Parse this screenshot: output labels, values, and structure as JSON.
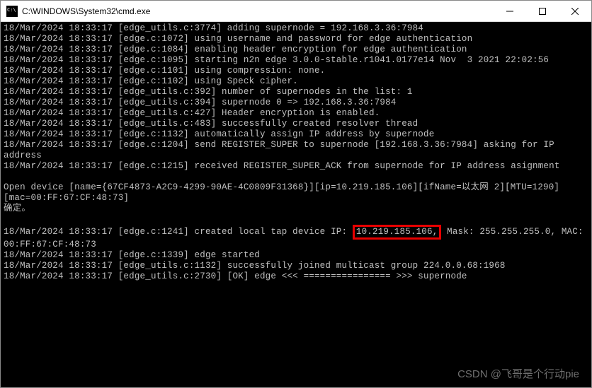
{
  "window": {
    "title": "C:\\WINDOWS\\System32\\cmd.exe"
  },
  "log": {
    "ts": "18/Mar/2024 18:33:17",
    "l1": "[edge_utils.c:3774] adding supernode = 192.168.3.36:7984",
    "l2": "[edge.c:1072] using username and password for edge authentication",
    "l3": "[edge.c:1084] enabling header encryption for edge authentication",
    "l4": "[edge.c:1095] starting n2n edge 3.0.0-stable.r1041.0177e14 Nov  3 2021 22:02:56",
    "l5": "[edge.c:1101] using compression: none.",
    "l6": "[edge.c:1102] using Speck cipher.",
    "l7": "[edge_utils.c:392] number of supernodes in the list: 1",
    "l8": "[edge_utils.c:394] supernode 0 => 192.168.3.36:7984",
    "l9": "[edge_utils.c:427] Header encryption is enabled.",
    "l10": "[edge_utils.c:483] successfully created resolver thread",
    "l11": "[edge.c:1132] automatically assign IP address by supernode",
    "l12": "[edge.c:1204] send REGISTER_SUPER to supernode [192.168.3.36:7984] asking for IP address",
    "l13": "[edge.c:1215] received REGISTER_SUPER_ACK from supernode for IP address asignment",
    "opendev": "Open device [name={67CF4873-A2C9-4299-90AE-4C0809F31368}][ip=10.219.185.106][ifName=以太网 2][MTU=1290][mac=00:FF:67:CF:48:73]",
    "ok": "确定。",
    "created_prefix": "[edge.c:1241] created local tap device IP: ",
    "created_ip": "10.219.185.106,",
    "created_suffix": " Mask: 255.255.255.0, MAC: 00:FF:67:CF:48:73",
    "l15": "[edge.c:1339] edge started",
    "l16": "[edge_utils.c:1132] successfully joined multicast group 224.0.0.68:1968",
    "l17": "[edge_utils.c:2730] [OK] edge <<< ================ >>> supernode"
  },
  "watermark": "CSDN @飞哥是个行动pie"
}
